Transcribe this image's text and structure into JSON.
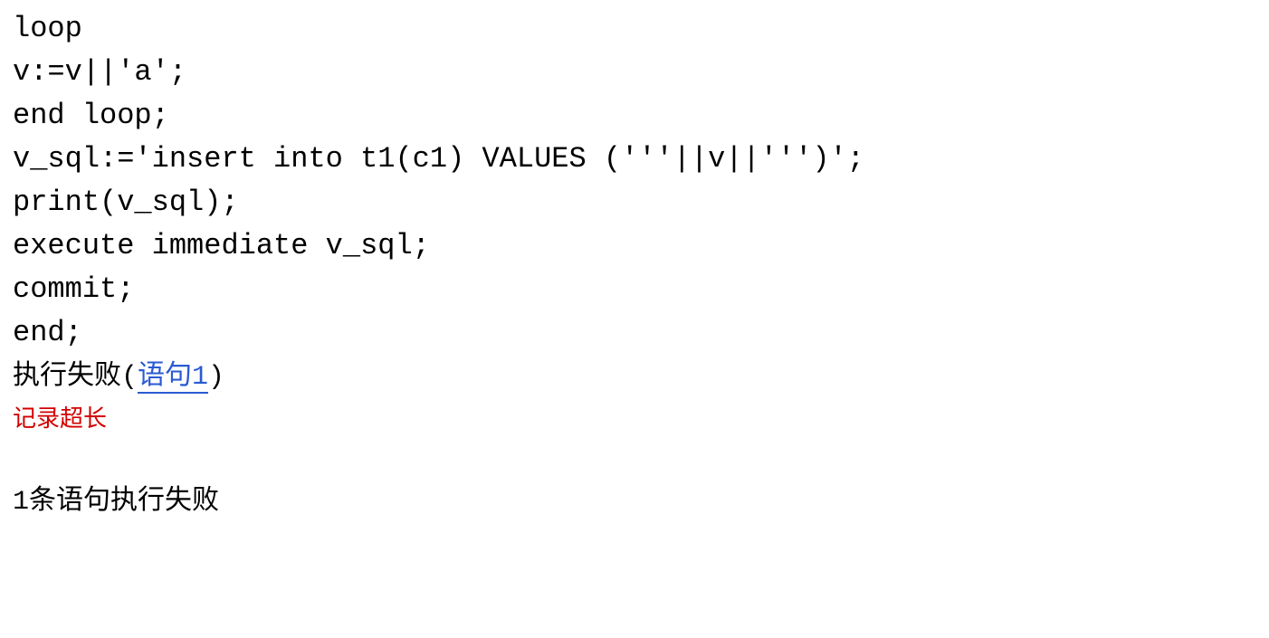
{
  "code": {
    "line1": "loop",
    "line2": "v:=v||'a';",
    "line3": "end loop;",
    "line4": "v_sql:='insert into t1(c1) VALUES ('''||v||''')';",
    "line5": "print(v_sql);",
    "line6": "execute immediate v_sql;",
    "line7": "commit;",
    "line8": "end;"
  },
  "status": {
    "prefix": "执行失败",
    "paren_open": "(",
    "link_text": "语句",
    "link_num": "1",
    "paren_close": ")"
  },
  "error": {
    "message": "记录超长"
  },
  "summary": {
    "count": "1",
    "text": "条语句执行失败"
  }
}
